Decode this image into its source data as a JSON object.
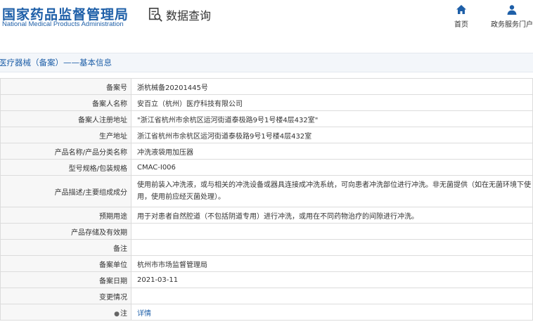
{
  "header": {
    "logo_cn": "国家药品监督管理局",
    "logo_en": "National Medical Products Administration",
    "query_label": "数据查询",
    "nav": [
      {
        "label": "首页",
        "icon": "home-icon"
      },
      {
        "label": "政务服务门户",
        "icon": "user-icon"
      }
    ]
  },
  "section": {
    "title": "医疗器械（备案）——基本信息"
  },
  "rows": [
    {
      "label": "备案号",
      "value": "浙杭械备20201445号"
    },
    {
      "label": "备案人名称",
      "value": "安百立（杭州）医疗科技有限公司"
    },
    {
      "label": "备案人注册地址",
      "value": "\"浙江省杭州市余杭区运河街道泰极路9号1号楼4层432室\""
    },
    {
      "label": "生产地址",
      "value": "浙江省杭州市余杭区运河街道泰极路9号1号楼4层432室"
    },
    {
      "label": "产品名称/产品分类名称",
      "value": "冲洗液袋用加压器"
    },
    {
      "label": "型号规格/包装规格",
      "value": "CMAC-I006"
    },
    {
      "label": "产品描述/主要组成成分",
      "value": "使用前装入冲洗液，或与相关的冲洗设备或器具连接成冲洗系统，可向患者冲洗部位进行冲洗。非无菌提供（如在无菌环境下使用，使用前应经灭菌处理）。"
    },
    {
      "label": "预期用途",
      "value": "用于对患者自然腔道（不包括阴道专用）进行冲洗，或用在不同药物治疗的间隙进行冲洗。"
    },
    {
      "label": "产品存储及有效期",
      "value": ""
    },
    {
      "label": "备注",
      "value": ""
    },
    {
      "label": "备案单位",
      "value": "杭州市市场监督管理局"
    },
    {
      "label": "备案日期",
      "value": "2021-03-11"
    },
    {
      "label": "变更情况",
      "value": ""
    },
    {
      "label": "注",
      "value": "详情"
    }
  ]
}
